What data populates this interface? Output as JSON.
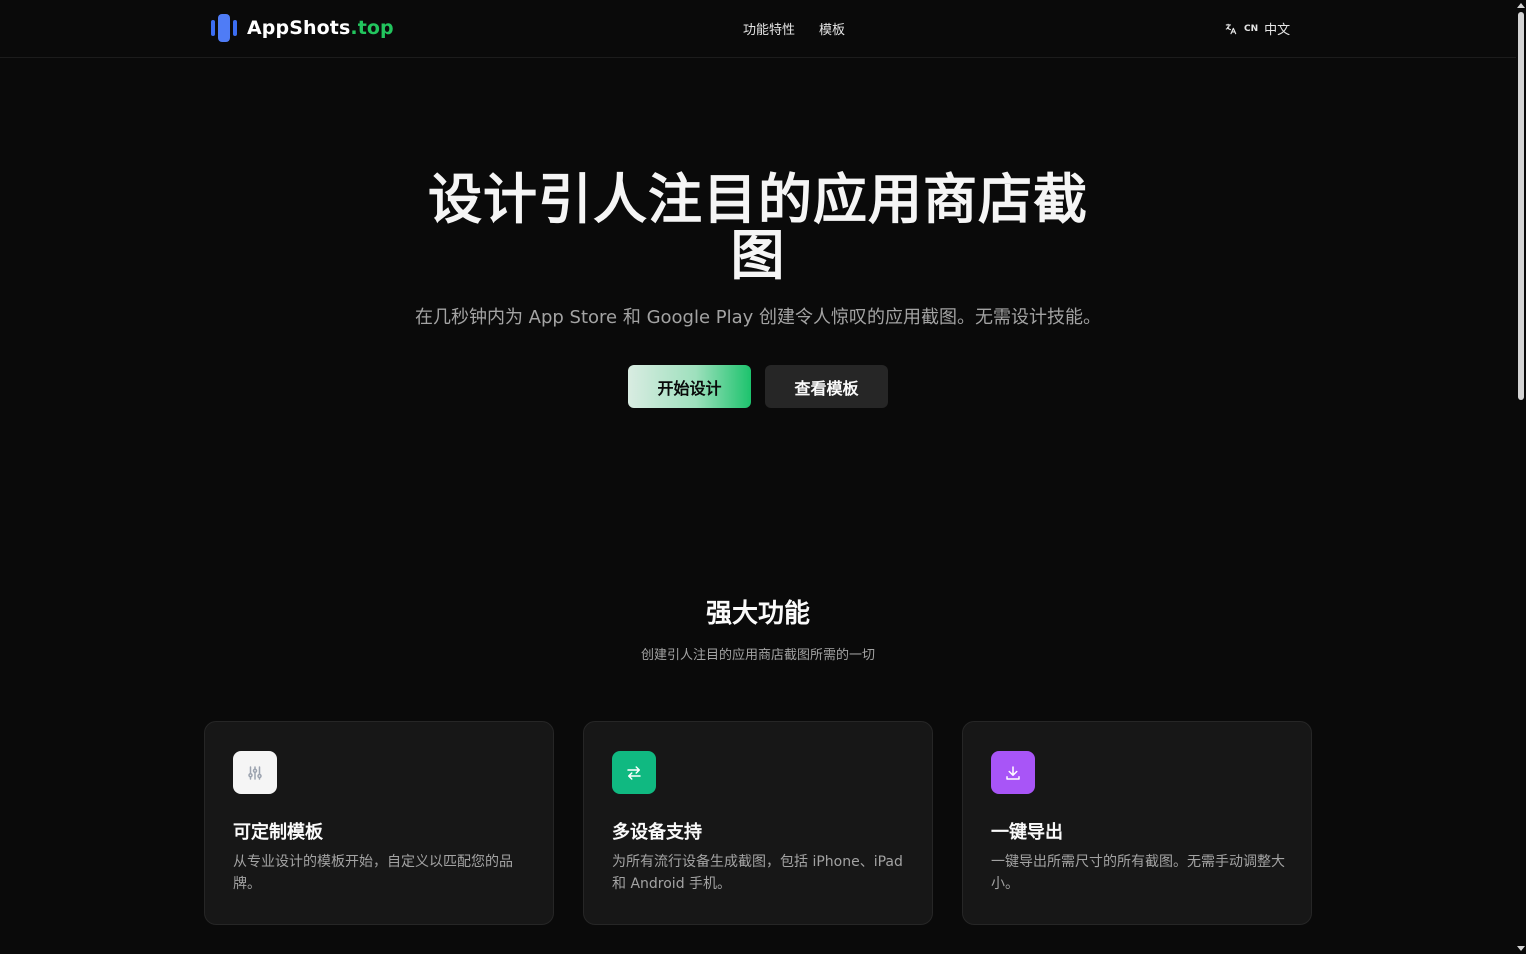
{
  "header": {
    "logo_name": "AppShots",
    "logo_tld": ".top",
    "nav": [
      {
        "label": "功能特性"
      },
      {
        "label": "模板"
      }
    ],
    "lang_code": "CN",
    "lang_label": "中文"
  },
  "hero": {
    "title": "设计引人注目的应用商店截图",
    "subtitle": "在几秒钟内为 App Store 和 Google Play 创建令人惊叹的应用截图。无需设计技能。",
    "primary_cta": "开始设计",
    "secondary_cta": "查看模板"
  },
  "features": {
    "title": "强大功能",
    "subtitle": "创建引人注目的应用商店截图所需的一切",
    "cards": [
      {
        "title": "可定制模板",
        "desc": "从专业设计的模板开始，自定义以匹配您的品牌。",
        "icon": "sliders-icon",
        "icon_bg": "#f5f5f5"
      },
      {
        "title": "多设备支持",
        "desc": "为所有流行设备生成截图，包括 iPhone、iPad 和 Android 手机。",
        "icon": "swap-arrows-icon",
        "icon_bg": "#10b981"
      },
      {
        "title": "一键导出",
        "desc": "一键导出所需尺寸的所有截图。无需手动调整大小。",
        "icon": "download-icon",
        "icon_bg": "#a855f7"
      }
    ]
  },
  "colors": {
    "background": "#0a0a0a",
    "card": "#171717",
    "accent_green": "#22c55e",
    "brand_blue": "#4f7cf6"
  }
}
